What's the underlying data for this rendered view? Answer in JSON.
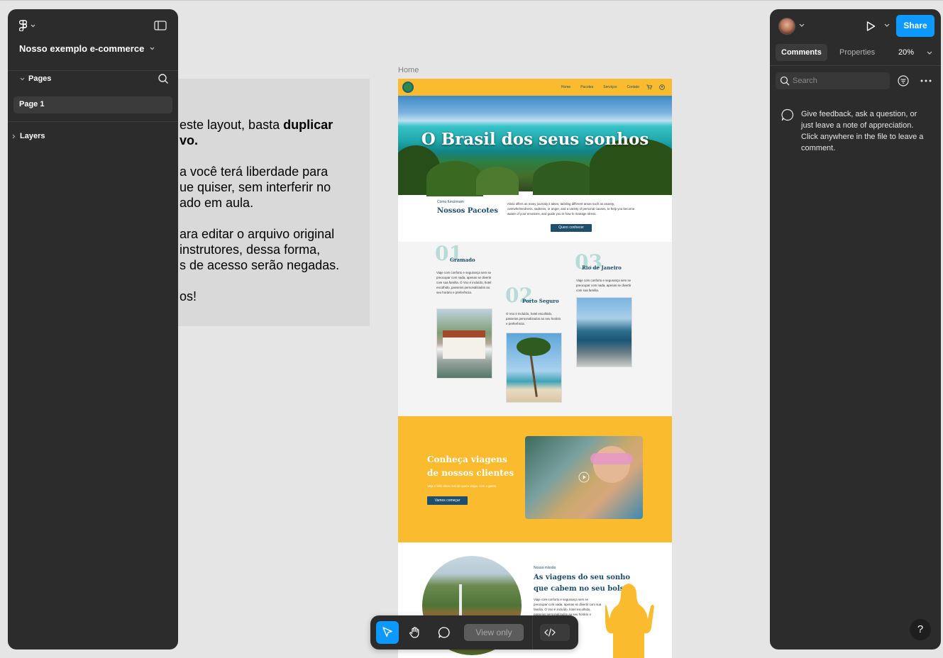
{
  "left_panel": {
    "file_name": "Nosso exemplo e-commerce",
    "pages_label": "Pages",
    "pages": [
      {
        "label": "Page 1"
      }
    ],
    "layers_label": "Layers"
  },
  "canvas": {
    "note_lines": [
      {
        "pre": "este layout, basta ",
        "bold": "duplicar"
      },
      {
        "pre": "",
        "bold": "vo."
      },
      {
        "pre": "a você terá liberdade para",
        "bold": ""
      },
      {
        "pre": "ue quiser, sem interferir no",
        "bold": ""
      },
      {
        "pre": "ado em aula.",
        "bold": ""
      },
      {
        "pre": "ara editar o arquivo original",
        "bold": ""
      },
      {
        "pre": " instrutores, dessa forma,",
        "bold": ""
      },
      {
        "pre": "s de acesso serão negadas.",
        "bold": ""
      },
      {
        "pre": "os!",
        "bold": ""
      }
    ],
    "frame_label": "Home",
    "site": {
      "nav": [
        "Home",
        "Pacotes",
        "Serviços",
        "Contato"
      ],
      "hero_title": "O Brasil dos seus sonhos",
      "how_small": "Como funcionam",
      "how_title": "Nossos Pacotes",
      "how_text": "Alivio offers as many journaly it takes, tackling different areas such as anxiety, overwhelmedness, sadness, or anger, and a variety of personal causes, to help you become aware of your emotions, and guide you in how to manage stress.",
      "how_button": "Quero conhecer",
      "packages": [
        {
          "num": "01",
          "name": "Gramado",
          "text": "Viaje com conforto e segurança sem se preocupar com nada, apenas se divertir com sua família. O Voo é incluído, hotel escolhido, passeios personalizados ao seu horário e preferência."
        },
        {
          "num": "02",
          "name": "Porto Seguro",
          "text": "O Voo é incluído, hotel escolhido, passeios personalizados ao seu horário e preferência."
        },
        {
          "num": "03",
          "name": "Rio de Janeiro",
          "text": "Viaje com conforto e segurança sem se preocupar com nada, apenas se divertir com sua família."
        }
      ],
      "clients_title_1": "Conheça viagens",
      "clients_title_2": "de nossos clientes",
      "clients_text": "Veja o feliz Alem real de quem viajou com a gente.",
      "clients_button": "Vamos começar",
      "mission_small": "Nossa missão",
      "mission_title_1": "As viagens do seu sonho",
      "mission_title_2": "que cabem no seu bolso",
      "mission_text": "Viaje com conforto e segurança sem se preocupar com nada, apenas se divertir com sua família. O Voo é incluído, hotel escolhido, passeios personalizados ao seu horário e preferência."
    }
  },
  "right_panel": {
    "share_label": "Share",
    "tabs": [
      "Comments",
      "Properties"
    ],
    "zoom": "20%",
    "search_placeholder": "Search",
    "comment_hint": "Give feedback, ask a question, or just leave a note of appreciation. Click anywhere in the file to leave a comment.",
    "help": "?"
  },
  "toolbar": {
    "view_only": "View only"
  },
  "colors": {
    "panel_bg": "#2c2c2c",
    "accent": "#0d99ff",
    "canvas_bg": "#e5e5e5",
    "site_yellow": "#fbbb2e",
    "site_navy": "#1d4e6b"
  }
}
